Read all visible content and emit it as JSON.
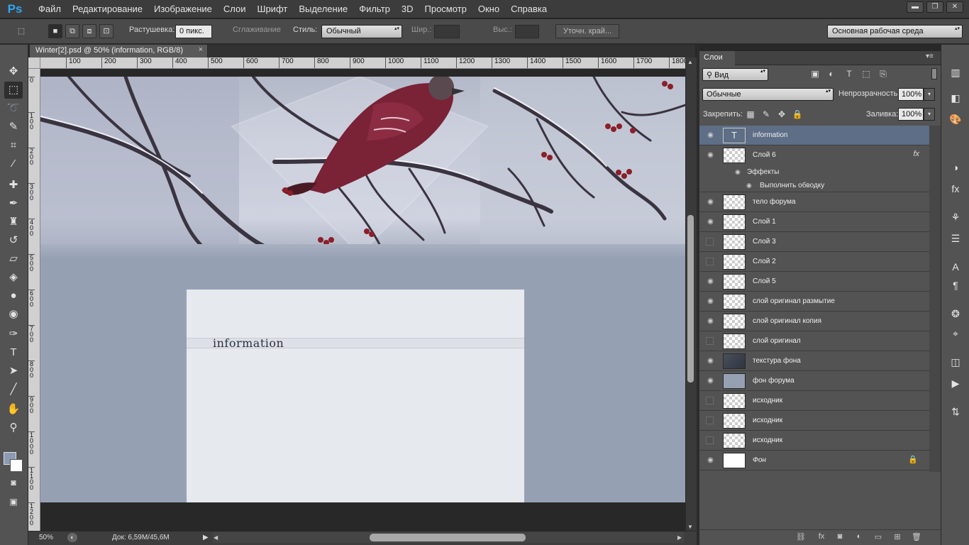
{
  "app": {
    "logo": "Ps"
  },
  "menu": [
    "Файл",
    "Редактирование",
    "Изображение",
    "Слои",
    "Шрифт",
    "Выделение",
    "Фильтр",
    "3D",
    "Просмотр",
    "Окно",
    "Справка"
  ],
  "window_controls": {
    "minimize": "▬",
    "restore": "❐",
    "close": "✕"
  },
  "options": {
    "feather_label": "Растушевка:",
    "feather_value": "0 пикс.",
    "antialias_label": "Сглаживание",
    "style_label": "Стиль:",
    "style_value": "Обычный",
    "width_label": "Шир.:",
    "height_label": "Выс.:",
    "refine_edge": "Уточн. край...",
    "workspace": "Основная рабочая среда"
  },
  "document": {
    "tab_title": "Winter[2].psd @ 50% (information, RGB/8)",
    "close": "×"
  },
  "ruler": {
    "h_labels": [
      "100",
      "200",
      "300",
      "400",
      "500",
      "600",
      "700",
      "800",
      "900",
      "1000",
      "1100",
      "1200",
      "1300",
      "1400",
      "1500",
      "1600",
      "1700",
      "1800"
    ],
    "v_labels": [
      "0",
      "1 0 0",
      "2 0 0",
      "3 0 0",
      "4 0 0",
      "5 0 0",
      "6 0 0",
      "7 0 0",
      "8 0 0",
      "9 0 0",
      "1 0 0 0",
      "1 1 0 0",
      "1 2 0 0"
    ]
  },
  "canvas": {
    "info_text": "information",
    "bg_color": "#95a1b3",
    "content_color": "#e6e9ee"
  },
  "status": {
    "zoom": "50%",
    "doc_size": "Док: 6,59M/45,6M"
  },
  "layers_panel": {
    "tab": "Слои",
    "filter_kind": "Вид",
    "blend_mode": "Обычные",
    "opacity_label": "Непрозрачность:",
    "opacity_value": "100%",
    "lock_label": "Закрепить:",
    "fill_label": "Заливка:",
    "fill_value": "100%",
    "effects_label": "Эффекты",
    "stroke_label": "Выполнить обводку",
    "layers": [
      {
        "name": "information",
        "visible": true,
        "kind": "text"
      },
      {
        "name": "Слой 6",
        "visible": true,
        "kind": "pixel",
        "fx": "fx"
      },
      {
        "name": "тело форума",
        "visible": true,
        "kind": "pixel"
      },
      {
        "name": "Слой 1",
        "visible": true,
        "kind": "pixel"
      },
      {
        "name": "Слой 3",
        "visible": false,
        "kind": "pixel"
      },
      {
        "name": "Слой 2",
        "visible": false,
        "kind": "pixel"
      },
      {
        "name": "Слой 5",
        "visible": true,
        "kind": "pixel"
      },
      {
        "name": "слой оригинал размытие",
        "visible": true,
        "kind": "pixel"
      },
      {
        "name": "слой оригинал копия",
        "visible": true,
        "kind": "pixel"
      },
      {
        "name": "слой оригинал",
        "visible": false,
        "kind": "pixel"
      },
      {
        "name": "текстура фона",
        "visible": true,
        "kind": "texture"
      },
      {
        "name": "фон форума",
        "visible": true,
        "kind": "fill"
      },
      {
        "name": "исходник",
        "visible": false,
        "kind": "pixel"
      },
      {
        "name": "исходник",
        "visible": false,
        "kind": "pixel"
      },
      {
        "name": "исходник",
        "visible": false,
        "kind": "pixel"
      },
      {
        "name": "Фон",
        "visible": true,
        "kind": "background",
        "locked": true
      }
    ]
  },
  "icons": {
    "tools": [
      "move-icon",
      "marquee-icon",
      "lasso-icon",
      "quick-select-icon",
      "crop-icon",
      "eyedropper-icon",
      "healing-icon",
      "brush-icon",
      "stamp-icon",
      "history-brush-icon",
      "eraser-icon",
      "paint-bucket-icon",
      "blur-icon",
      "dodge-icon",
      "pen-icon",
      "type-icon",
      "path-select-icon",
      "line-icon",
      "hand-icon",
      "zoom-icon"
    ]
  }
}
